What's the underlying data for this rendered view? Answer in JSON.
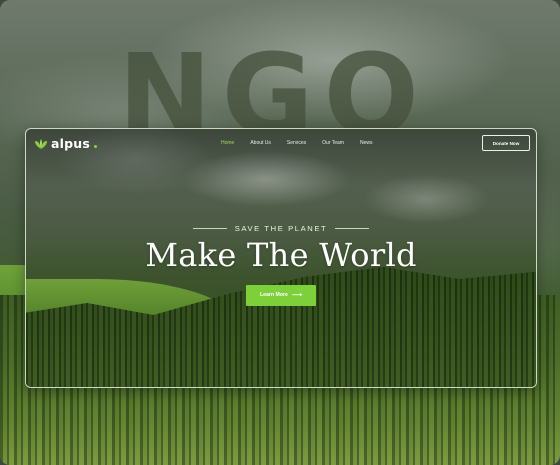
{
  "background": {
    "big_word": "NGO"
  },
  "site": {
    "logo_text": "alpus",
    "nav": {
      "items": [
        {
          "label": "Home",
          "active": true
        },
        {
          "label": "About Us",
          "active": false
        },
        {
          "label": "Services",
          "active": false
        },
        {
          "label": "Our Team",
          "active": false
        },
        {
          "label": "News",
          "active": false
        }
      ],
      "donate_label": "Donate Now"
    },
    "hero": {
      "eyebrow": "SAVE THE PLANET",
      "headline": "Make The World",
      "cta_label": "Learn More",
      "cta_icon": "arrow-right-icon"
    },
    "colors": {
      "accent": "#7dd03a",
      "active_nav": "#9fd85a",
      "text": "#ffffff"
    }
  }
}
